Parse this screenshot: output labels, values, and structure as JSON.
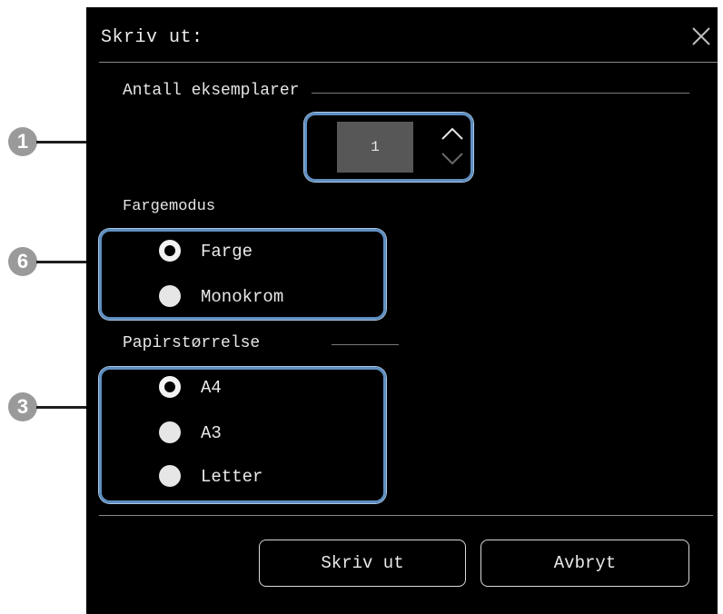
{
  "dialog": {
    "title": "Skriv ut:",
    "close_icon": "close-icon"
  },
  "copies": {
    "label": "Antall eksemplarer",
    "value": "1",
    "up_icon": "chevron-up-icon",
    "down_icon": "chevron-down-icon"
  },
  "color_mode": {
    "label": "Fargemodus",
    "options": [
      {
        "label": "Farge",
        "selected": true
      },
      {
        "label": "Monokrom",
        "selected": false
      }
    ]
  },
  "paper_size": {
    "label": "Papirstørrelse",
    "options": [
      {
        "label": "A4",
        "selected": true
      },
      {
        "label": "A3",
        "selected": false
      },
      {
        "label": "Letter",
        "selected": false
      }
    ]
  },
  "buttons": {
    "print": "Skriv ut",
    "cancel": "Avbryt"
  },
  "callouts": [
    "1",
    "6",
    "3"
  ],
  "colors": {
    "background": "#000000",
    "highlight": "#5f8fc1",
    "field": "#575757",
    "callout": "#9a9a9a"
  }
}
